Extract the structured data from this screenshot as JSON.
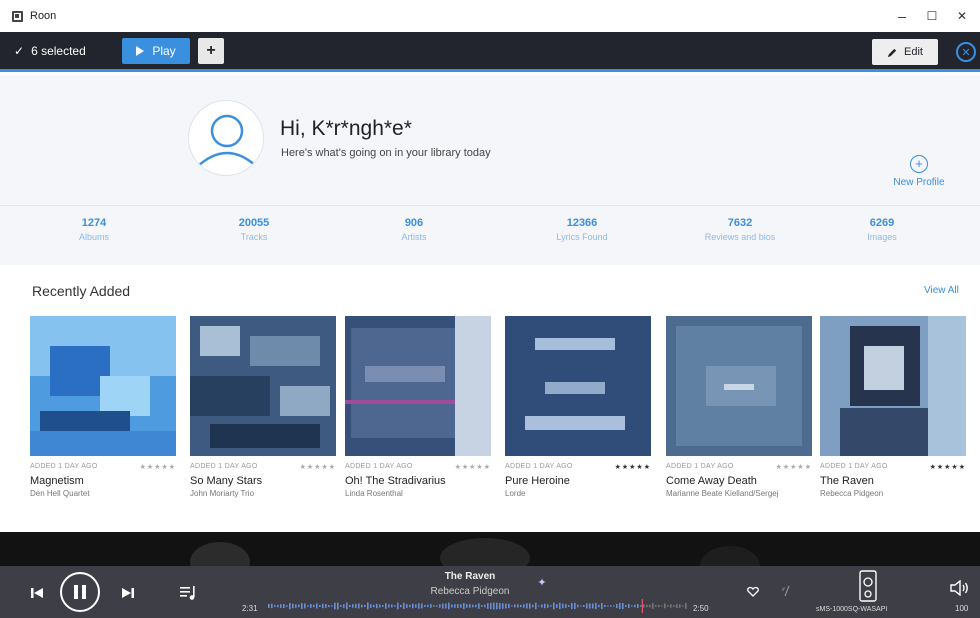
{
  "window": {
    "title": "Roon",
    "controls": {
      "minimize": "–",
      "maximize": "☐",
      "close": "✕"
    }
  },
  "selection_bar": {
    "count_label": "6 selected",
    "play_label": "Play",
    "add_label": "+",
    "edit_label": "Edit",
    "close_label": "✕",
    "accent_color": "#3a8fde"
  },
  "profile": {
    "greeting": "Hi, K*r*ngh*e*",
    "subtitle": "Here's what's going on in your library today",
    "new_profile_icon": "+",
    "new_profile_label": "New Profile"
  },
  "stats": [
    {
      "value": "1274",
      "label": "Albums"
    },
    {
      "value": "20055",
      "label": "Tracks"
    },
    {
      "value": "906",
      "label": "Artists"
    },
    {
      "value": "12366",
      "label": "Lyrics Found"
    },
    {
      "value": "7632",
      "label": "Reviews and bios"
    },
    {
      "value": "6269",
      "label": "Images"
    }
  ],
  "recently_added": {
    "title": "Recently Added",
    "view_all": "View All",
    "albums": [
      {
        "added": "ADDED 1 DAY AGO",
        "stars": "★★★★★",
        "title": "Magnetism",
        "artist": "Den Hell Quartet"
      },
      {
        "added": "ADDED 1 DAY AGO",
        "stars": "★★★★★",
        "title": "So Many Stars",
        "artist": "John Moriarty Trio"
      },
      {
        "added": "ADDED 1 DAY AGO",
        "stars": "★★★★★",
        "title": "Oh! The Stradivarius",
        "artist": "Linda Rosenthal"
      },
      {
        "added": "ADDED 1 DAY AGO",
        "stars": "★★★★★",
        "title": "Pure Heroine",
        "artist": "Lorde"
      },
      {
        "added": "ADDED 1 DAY AGO",
        "stars": "★★★★★",
        "title": "Come Away Death",
        "artist": "Marianne Beate Kielland/Sergej"
      },
      {
        "added": "ADDED 1 DAY AGO",
        "stars": "★★★★★",
        "title": "The Raven",
        "artist": "Rebecca Pidgeon"
      }
    ]
  },
  "now_playing": {
    "title": "The Raven",
    "artist": "Rebecca Pidgeon",
    "elapsed": "2:31",
    "duration": "2:50",
    "progress": 0.89,
    "zone": "sMS-1000SQ-WASAPI",
    "volume": "100"
  }
}
